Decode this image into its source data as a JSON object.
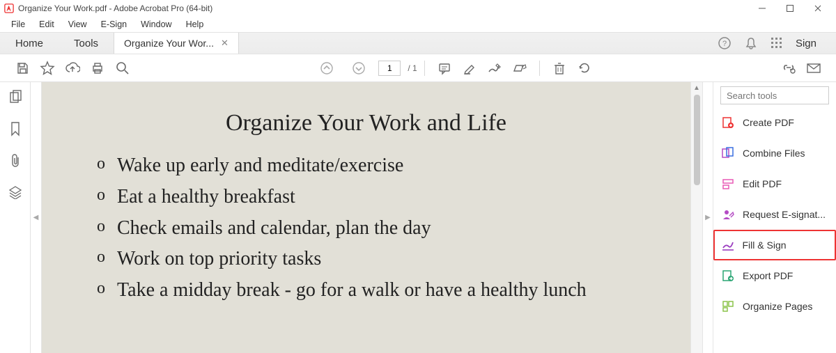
{
  "window": {
    "title": "Organize Your Work.pdf - Adobe Acrobat Pro (64-bit)"
  },
  "menu": {
    "items": [
      "File",
      "Edit",
      "View",
      "E-Sign",
      "Window",
      "Help"
    ]
  },
  "tabrow": {
    "home": "Home",
    "tools": "Tools",
    "doc_tab": "Organize Your Wor...",
    "sign": "Sign"
  },
  "toolbar": {
    "page_current": "1",
    "page_total": "/  1"
  },
  "document": {
    "title": "Organize Your Work and Life",
    "items": [
      "Wake up early and meditate/exercise",
      "Eat a healthy breakfast",
      "Check emails and calendar, plan the day",
      "Work on top priority tasks",
      "Take a midday break - go for a walk or have a healthy lunch"
    ]
  },
  "right_panel": {
    "search_placeholder": "Search tools",
    "tools": [
      {
        "label": "Create PDF"
      },
      {
        "label": "Combine Files"
      },
      {
        "label": "Edit PDF"
      },
      {
        "label": "Request E-signat..."
      },
      {
        "label": "Fill & Sign",
        "highlight": true
      },
      {
        "label": "Export PDF"
      },
      {
        "label": "Organize Pages"
      }
    ]
  }
}
